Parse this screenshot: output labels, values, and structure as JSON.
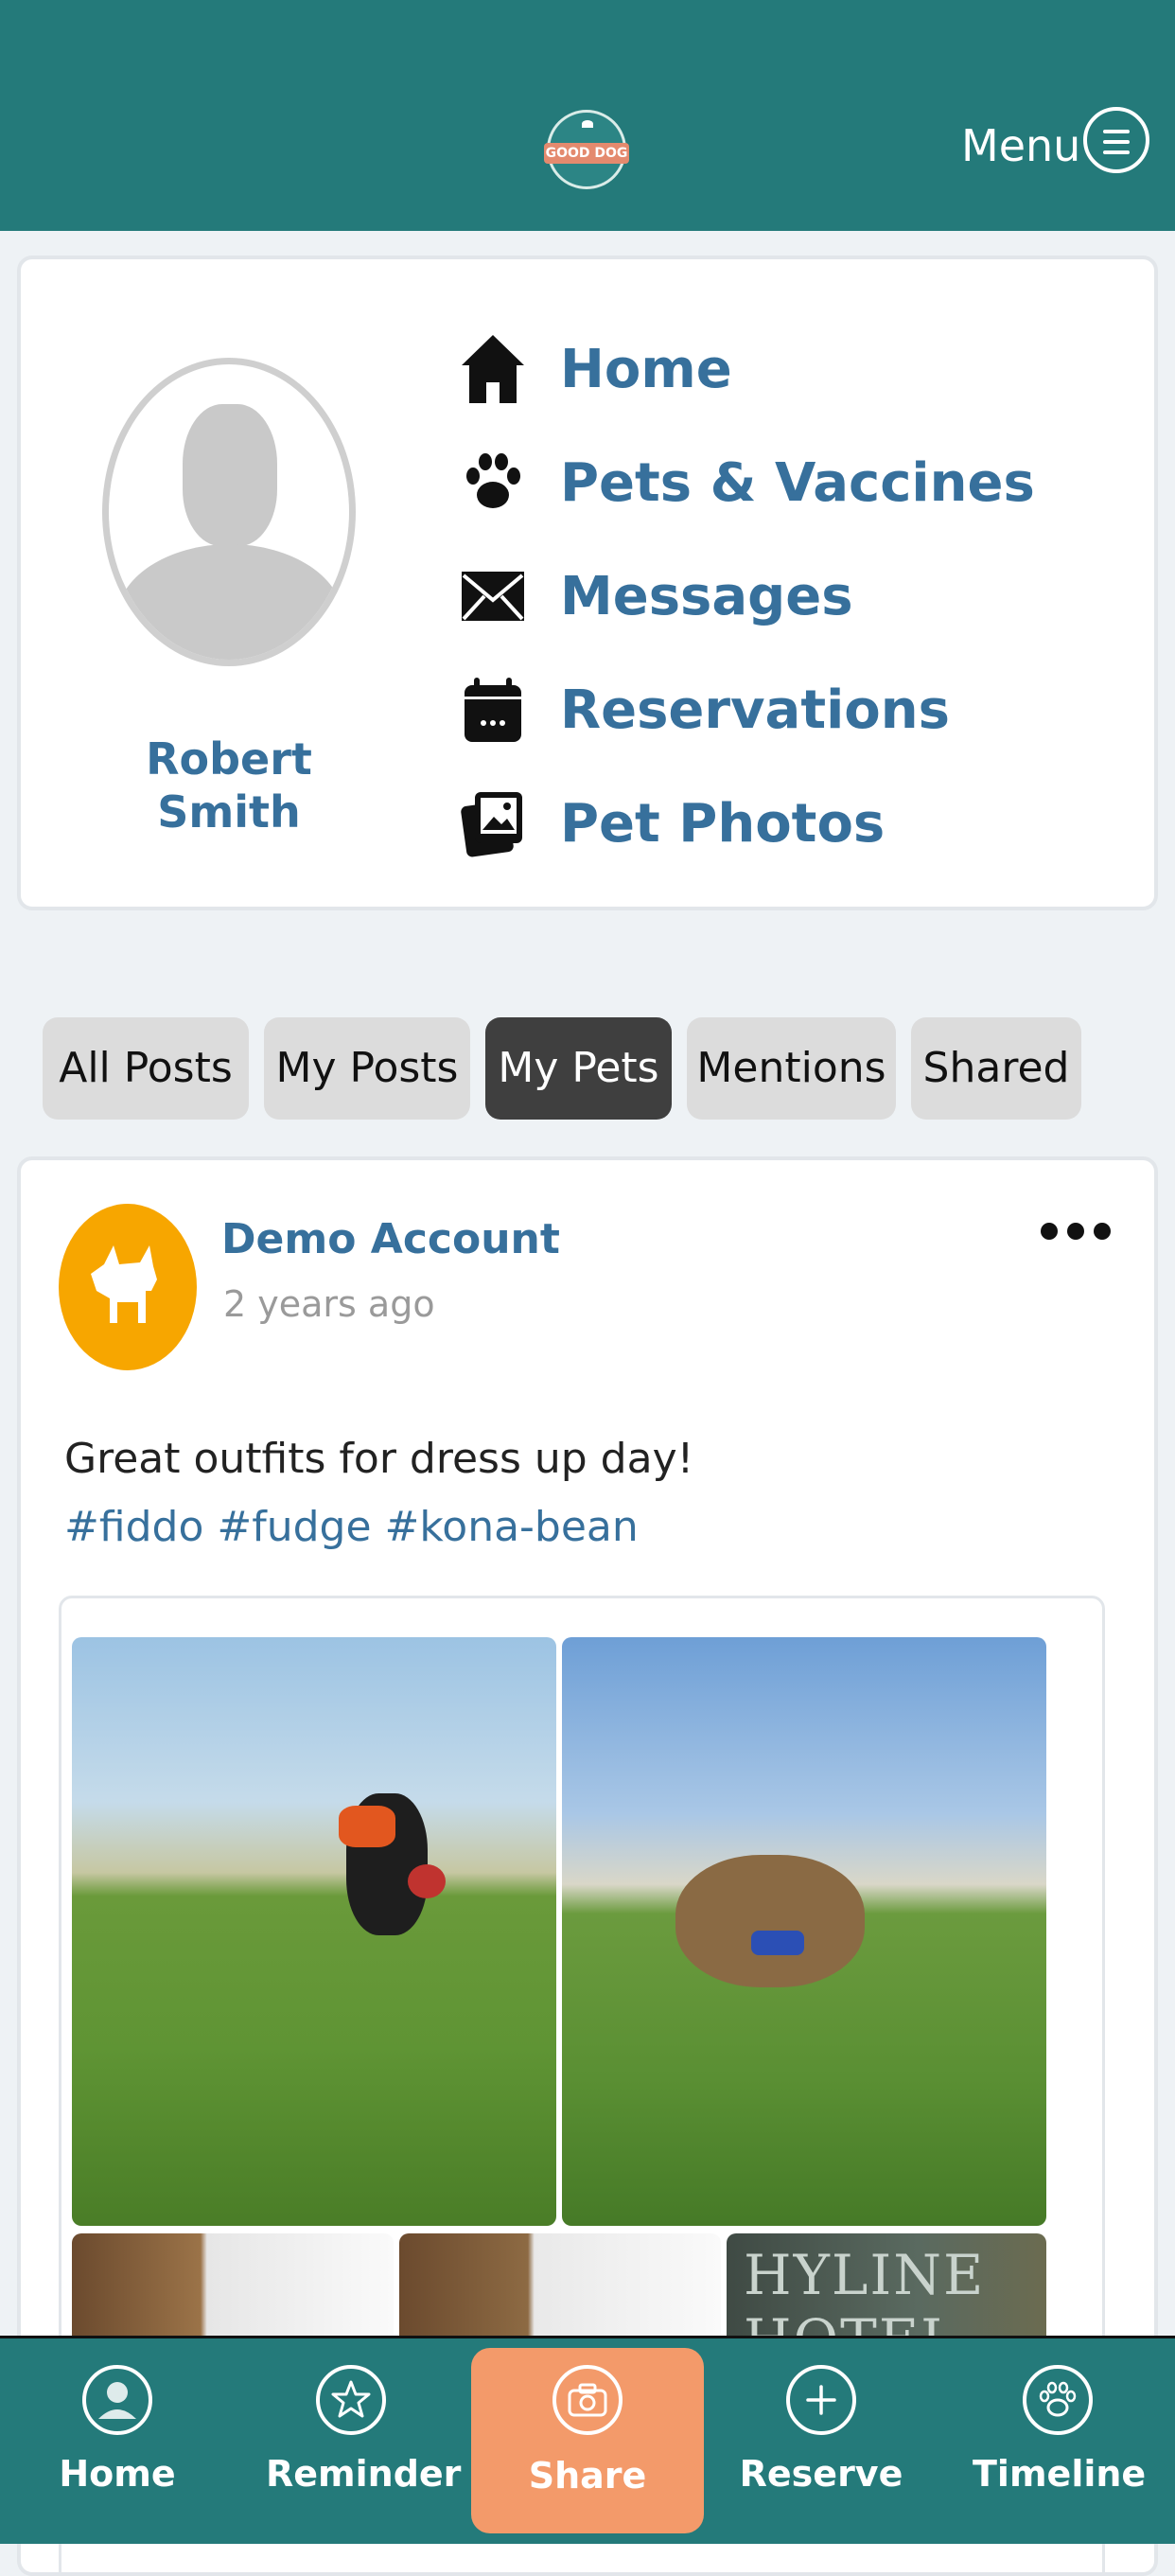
{
  "header": {
    "logo_text": "GOOD DOG",
    "menu_label": "Menu",
    "menu_icon": "hamburger-circle-icon"
  },
  "profile": {
    "name": "Robert Smith",
    "nav": [
      {
        "label": "Home",
        "icon": "home-icon"
      },
      {
        "label": "Pets & Vaccines",
        "icon": "paw-icon"
      },
      {
        "label": "Messages",
        "icon": "envelope-icon"
      },
      {
        "label": "Reservations",
        "icon": "calendar-icon"
      },
      {
        "label": "Pet Photos",
        "icon": "photos-icon"
      }
    ]
  },
  "tabs": {
    "items": [
      "All Posts",
      "My Posts",
      "My Pets",
      "Mentions",
      "Shared"
    ],
    "active": "My Pets"
  },
  "post": {
    "author": "Demo Account",
    "time": "2 years ago",
    "caption": "Great outfits for dress up day!",
    "tags": "#fiddo #fudge #kona-bean",
    "photo_text": "HYLINE HOTEL"
  },
  "bottom_nav": {
    "home": "Home",
    "reminder": "Reminder",
    "share": "Share",
    "reserve": "Reserve",
    "timeline": "Timeline"
  },
  "colors": {
    "primary": "#247a7a",
    "accent": "#f39a6a",
    "link": "#37709c",
    "avatar_bg": "#f7a600"
  }
}
